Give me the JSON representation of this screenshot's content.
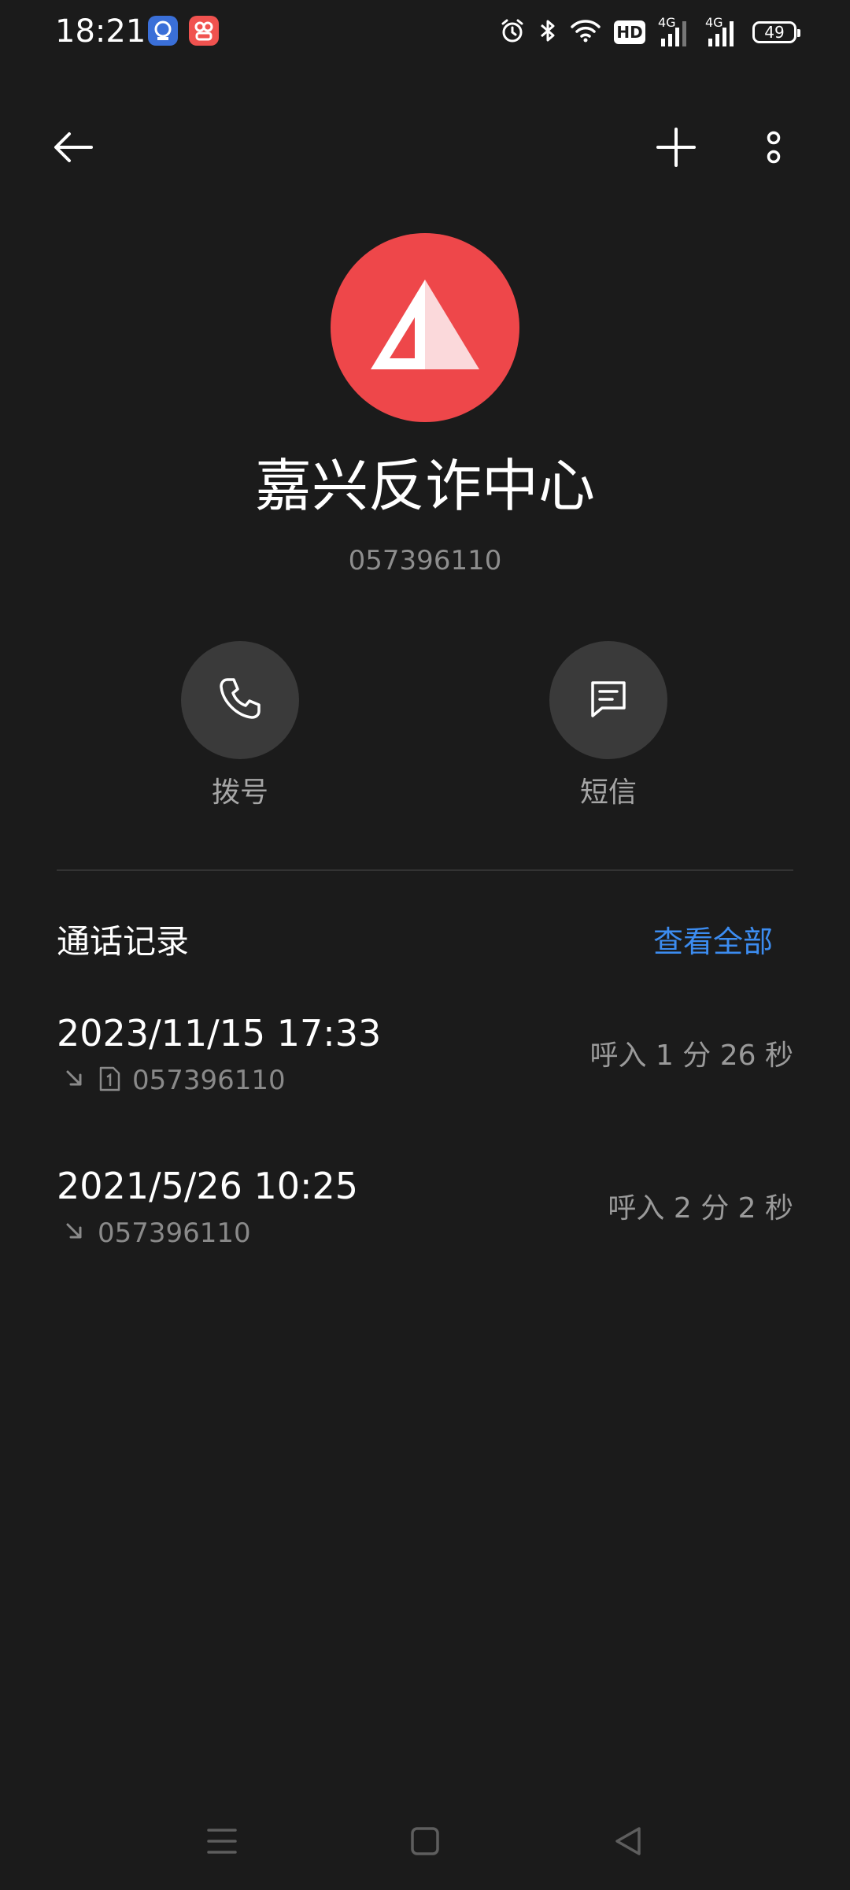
{
  "status_bar": {
    "time": "18:21",
    "icons": [
      "app-badge-blue-icon",
      "app-badge-red-icon",
      "alarm-icon",
      "bluetooth-icon",
      "wifi-icon",
      "hd-icon",
      "signal-4g-icon",
      "signal-4g-icon",
      "battery-icon"
    ],
    "hd_label": "HD",
    "network_1": "4G",
    "network_2": "4G",
    "battery": "49"
  },
  "top_bar": {
    "icons": [
      "back-arrow-icon",
      "add-icon",
      "more-vertical-icon"
    ]
  },
  "contact": {
    "name": "嘉兴反诈中心",
    "number": "057396110",
    "avatar_icon": "anti-fraud-triangle-icon",
    "avatar_color": "#ee474a"
  },
  "actions": [
    {
      "label": "拨号",
      "icon": "phone-icon"
    },
    {
      "label": "短信",
      "icon": "message-icon"
    }
  ],
  "call_log": {
    "title": "通话记录",
    "view_all": "查看全部",
    "accent_color": "#3c8cf0",
    "entries": [
      {
        "datetime": "2023/11/15 17:33",
        "number": "057396110",
        "detail": "呼入  1 分 26 秒",
        "sim_icon": true
      },
      {
        "datetime": "2021/5/26 10:25",
        "number": "057396110",
        "detail": "呼入  2 分 2 秒",
        "sim_icon": false
      }
    ]
  },
  "nav_bar": {
    "icons": [
      "menu-icon",
      "home-icon",
      "back-triangle-icon"
    ]
  }
}
